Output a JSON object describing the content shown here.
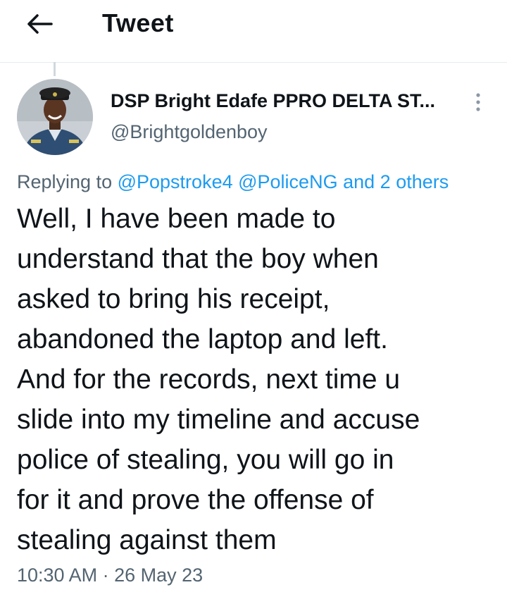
{
  "header": {
    "title": "Tweet",
    "back_icon": "arrow-left-icon"
  },
  "tweet": {
    "author_name": "DSP Bright Edafe PPRO DELTA ST...",
    "author_handle": "@Brightgoldenboy",
    "avatar": "profile-photo-police-officer",
    "more_icon": "vertical-ellipsis-icon",
    "reply_prefix": "Replying to",
    "reply_mentions": [
      "@Popstroke4",
      "@PoliceNG"
    ],
    "reply_and": "and",
    "reply_others": "2 others",
    "text": "Well, I have been made to\nunderstand that the boy when\nasked to bring his receipt,\nabandoned the laptop and left.\nAnd for the records, next time u\nslide into my timeline and accuse\npolice of stealing, you will go in\nfor it and prove the offense of\nstealing against them",
    "time": "10:30 AM",
    "separator": "·",
    "date": "26 May 23"
  },
  "colors": {
    "link": "#1d9bf0",
    "text": "#0f1419",
    "secondary": "#536471",
    "divider": "#e6ecf0"
  }
}
